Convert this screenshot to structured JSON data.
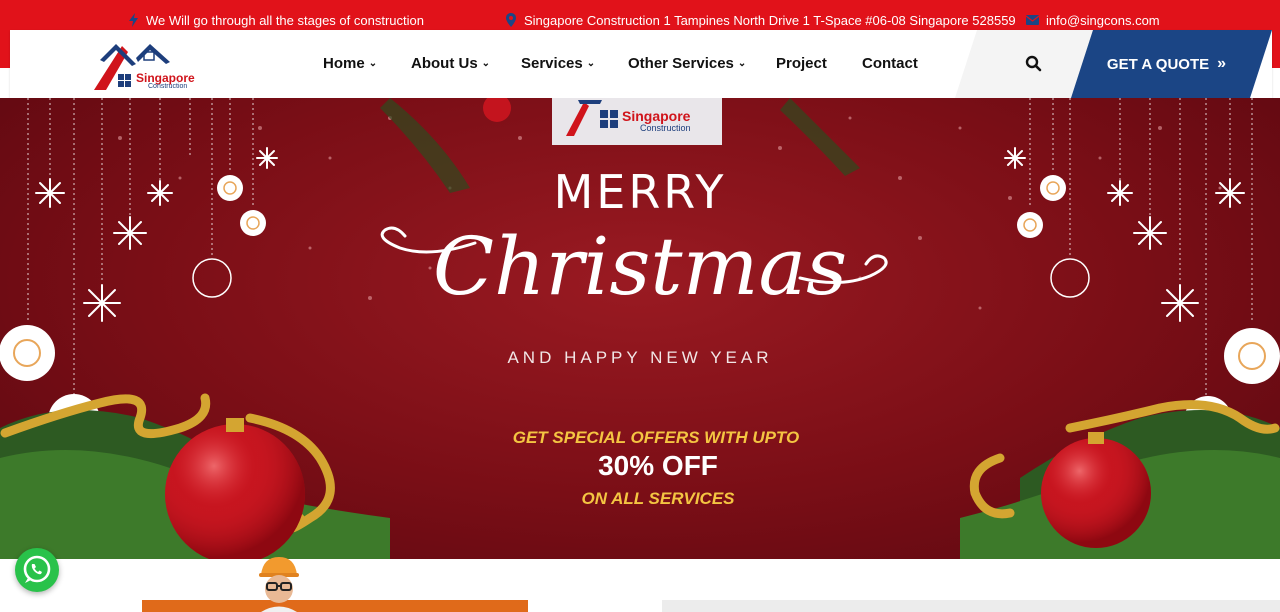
{
  "topbar": {
    "tagline": "We Will go through all the stages of construction",
    "address": "Singapore Construction 1 Tampines North Drive 1 T-Space #06-08 Singapore 528559",
    "email": "info@singcons.com",
    "bg_color": "#e1121a"
  },
  "logo": {
    "name": "Singapore",
    "sub": "Construction"
  },
  "nav": {
    "items": [
      {
        "label": "Home",
        "has_dropdown": true
      },
      {
        "label": "About Us",
        "has_dropdown": true
      },
      {
        "label": "Services",
        "has_dropdown": true
      },
      {
        "label": "Other Services",
        "has_dropdown": true
      },
      {
        "label": "Project",
        "has_dropdown": false
      },
      {
        "label": "Contact",
        "has_dropdown": false
      }
    ],
    "quote_button": "GET A QUOTE",
    "quote_color": "#1b4585"
  },
  "hero": {
    "merry": "MERRY",
    "christmas": "Christmas",
    "happy": "AND HAPPY NEW YEAR",
    "offer_line1": "GET SPECIAL OFFERS WITH UPTO",
    "offer_line2": "30% OFF",
    "offer_line3": "ON ALL SERVICES",
    "bg_color": "#7a0e16",
    "accent_gold": "#f4c542"
  },
  "icons": {
    "tagline": "bolt-icon",
    "address": "map-marker-icon",
    "email": "envelope-icon",
    "search": "search-icon",
    "whatsapp": "whatsapp-icon"
  }
}
